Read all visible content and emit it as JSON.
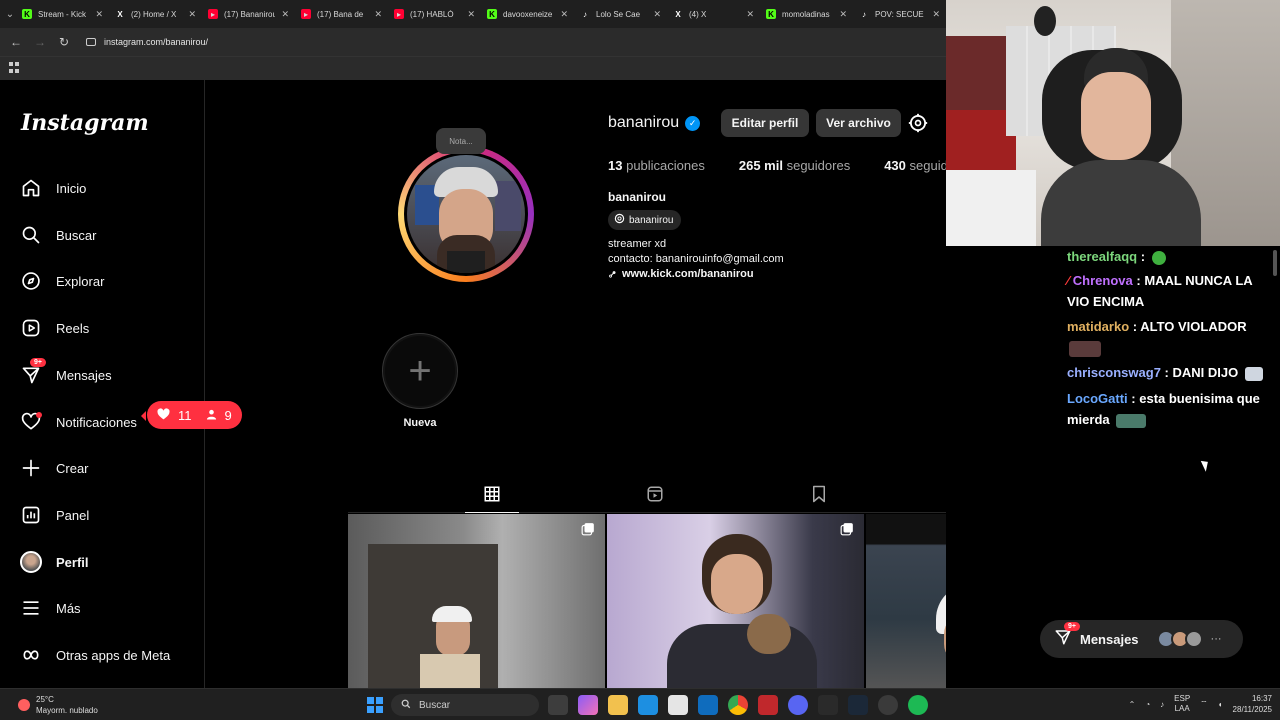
{
  "browser": {
    "tabs": [
      {
        "title": "Stream - Kick",
        "favicon": "kick-icon"
      },
      {
        "title": "(2) Home / X",
        "favicon": "x-icon"
      },
      {
        "title": "(17) Bananirou",
        "favicon": "youtube-icon"
      },
      {
        "title": "(17) Bana de",
        "favicon": "youtube-icon"
      },
      {
        "title": "(17) HABLÓ",
        "favicon": "youtube-icon"
      },
      {
        "title": "davooxeneize",
        "favicon": "kick-icon"
      },
      {
        "title": "Lolo Se Cae",
        "favicon": "tiktok-icon"
      },
      {
        "title": "(4) X",
        "favicon": "x-icon"
      },
      {
        "title": "momoladinas",
        "favicon": "kick-icon"
      },
      {
        "title": "POV: SECUE",
        "favicon": "tiktok-icon"
      }
    ],
    "url": "instagram.com/bananirou/"
  },
  "sidebar": {
    "logo": "Instagram",
    "items": [
      {
        "label": "Inicio",
        "icon": "home-icon"
      },
      {
        "label": "Buscar",
        "icon": "search-icon"
      },
      {
        "label": "Explorar",
        "icon": "compass-icon"
      },
      {
        "label": "Reels",
        "icon": "reels-icon"
      },
      {
        "label": "Mensajes",
        "icon": "messenger-icon",
        "badge": "9+"
      },
      {
        "label": "Notificaciones",
        "icon": "heart-icon"
      },
      {
        "label": "Crear",
        "icon": "plus-icon"
      },
      {
        "label": "Panel",
        "icon": "dashboard-icon"
      },
      {
        "label": "Perfil",
        "icon": "profile-avatar"
      },
      {
        "label": "Más",
        "icon": "menu-icon"
      },
      {
        "label": "Otras apps de Meta",
        "icon": "meta-icon"
      }
    ],
    "notifications_pill": {
      "likes": "11",
      "follows": "9"
    }
  },
  "profile": {
    "username": "bananirou",
    "nota": "Nota...",
    "edit_button": "Editar perfil",
    "archive_button": "Ver archivo",
    "stats": {
      "posts_value": "13",
      "posts_label": "publicaciones",
      "followers_value": "265 mil",
      "followers_label": "seguidores",
      "following_value": "430",
      "following_label": "seguidos"
    },
    "full_name": "bananirou",
    "threads_handle": "bananirou",
    "bio_line1": "streamer xd",
    "bio_line2": "contacto: bananirouinfo@gmail.com",
    "bio_link": "www.kick.com/bananirou",
    "new_highlight": "Nueva"
  },
  "chat": {
    "messages": [
      {
        "user": "therealfaqq",
        "text": "",
        "user_color": "#7cd67c"
      },
      {
        "user": "Chrenova",
        "text": "MAAL NUNCA LA VIO ENCIMA",
        "user_color": "#c070ff"
      },
      {
        "user": "matidarko",
        "text": "ALTO VIOLADOR",
        "user_color": "#e0b060"
      },
      {
        "user": "chrisconswag7",
        "text": "DANI DIJO",
        "user_color": "#9ab0ff"
      },
      {
        "user": "LocoGatti",
        "text": "esta buenisima que mierda",
        "user_color": "#6aa8ff"
      }
    ]
  },
  "dm_pill": {
    "label": "Mensajes",
    "badge": "9+"
  },
  "taskbar": {
    "weather_temp": "25°C",
    "weather_desc": "Mayorm. nublado",
    "search_placeholder": "Buscar",
    "lang_top": "ESP",
    "lang_bottom": "LAA",
    "time": "16:37",
    "date": "28/11/2025"
  }
}
